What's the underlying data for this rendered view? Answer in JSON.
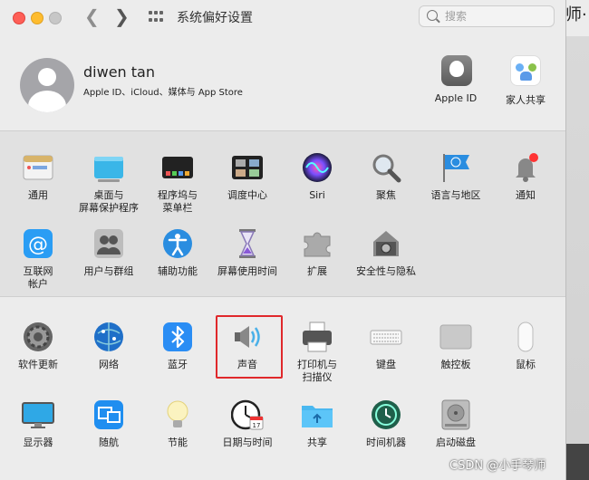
{
  "window": {
    "title": "系统偏好设置"
  },
  "search": {
    "placeholder": "搜索"
  },
  "user": {
    "name": "diwen tan",
    "subtitle": "Apple ID、iCloud、媒体与 App Store"
  },
  "top_items": [
    {
      "label": "Apple ID",
      "icon": "apple-id-icon"
    },
    {
      "label": "家人共享",
      "icon": "family-sharing-icon"
    }
  ],
  "section1": [
    {
      "label": "通用",
      "icon": "general-icon"
    },
    {
      "label": "桌面与\n屏幕保护程序",
      "icon": "desktop-icon"
    },
    {
      "label": "程序坞与\n菜单栏",
      "icon": "dock-icon"
    },
    {
      "label": "调度中心",
      "icon": "mission-control-icon"
    },
    {
      "label": "Siri",
      "icon": "siri-icon"
    },
    {
      "label": "聚焦",
      "icon": "spotlight-icon"
    },
    {
      "label": "语言与地区",
      "icon": "language-region-icon"
    },
    {
      "label": "通知",
      "icon": "notification-bell-icon"
    },
    {
      "label": "互联网\n帐户",
      "icon": "internet-accounts-icon"
    },
    {
      "label": "用户与群组",
      "icon": "users-groups-icon"
    },
    {
      "label": "辅助功能",
      "icon": "accessibility-icon"
    },
    {
      "label": "屏幕使用时间",
      "icon": "screen-time-icon"
    },
    {
      "label": "扩展",
      "icon": "extensions-icon"
    },
    {
      "label": "安全性与隐私",
      "icon": "security-privacy-icon"
    }
  ],
  "section2": [
    {
      "label": "软件更新",
      "icon": "software-update-icon"
    },
    {
      "label": "网络",
      "icon": "network-icon"
    },
    {
      "label": "蓝牙",
      "icon": "bluetooth-icon"
    },
    {
      "label": "声音",
      "icon": "sound-icon"
    },
    {
      "label": "打印机与\n扫描仪",
      "icon": "printer-icon"
    },
    {
      "label": "键盘",
      "icon": "keyboard-icon"
    },
    {
      "label": "触控板",
      "icon": "trackpad-icon"
    },
    {
      "label": "鼠标",
      "icon": "mouse-icon"
    },
    {
      "label": "显示器",
      "icon": "display-icon"
    },
    {
      "label": "随航",
      "icon": "sidecar-icon"
    },
    {
      "label": "节能",
      "icon": "energy-saver-icon"
    },
    {
      "label": "日期与时间",
      "icon": "date-time-icon"
    },
    {
      "label": "共享",
      "icon": "sharing-icon"
    },
    {
      "label": "时间机器",
      "icon": "time-machine-icon"
    },
    {
      "label": "启动磁盘",
      "icon": "startup-disk-icon"
    }
  ],
  "calendar_day": "17",
  "watermark": "CSDN @小手琴师",
  "bg_glyph": "师·",
  "colors": {
    "highlight": "#e0282b",
    "close": "#fe5f57",
    "minimize": "#febc2e"
  }
}
